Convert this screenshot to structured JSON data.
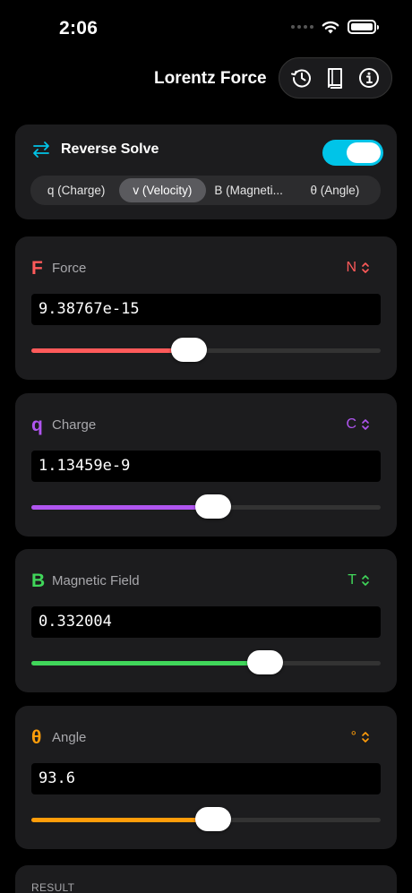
{
  "status": {
    "time": "2:06"
  },
  "nav": {
    "title": "Lorentz Force",
    "actions": [
      {
        "icon": "history-icon"
      },
      {
        "icon": "book-icon"
      },
      {
        "icon": "info-icon"
      }
    ]
  },
  "reverse": {
    "label": "Reverse Solve",
    "enabled": true,
    "options": [
      "q (Charge)",
      "v (Velocity)",
      "B (Magneti...",
      "θ (Angle)"
    ],
    "selected": "v (Velocity)",
    "accent": "#00c4e8"
  },
  "variables": [
    {
      "symbol": "F",
      "name": "Force",
      "unit": "N",
      "value": "9.38767e-15",
      "color": "#ff5a5a",
      "level": 0.45
    },
    {
      "symbol": "q",
      "name": "Charge",
      "unit": "C",
      "value": "1.13459e-9",
      "color": "#b055f0",
      "level": 0.52
    },
    {
      "symbol": "B",
      "name": "Magnetic Field",
      "unit": "T",
      "value": "0.332004",
      "color": "#40d65a",
      "level": 0.67
    },
    {
      "symbol": "θ",
      "name": "Angle",
      "unit": "°",
      "value": "93.6",
      "color": "#ff9d0a",
      "level": 0.52
    }
  ],
  "result": {
    "label": "RESULT"
  }
}
